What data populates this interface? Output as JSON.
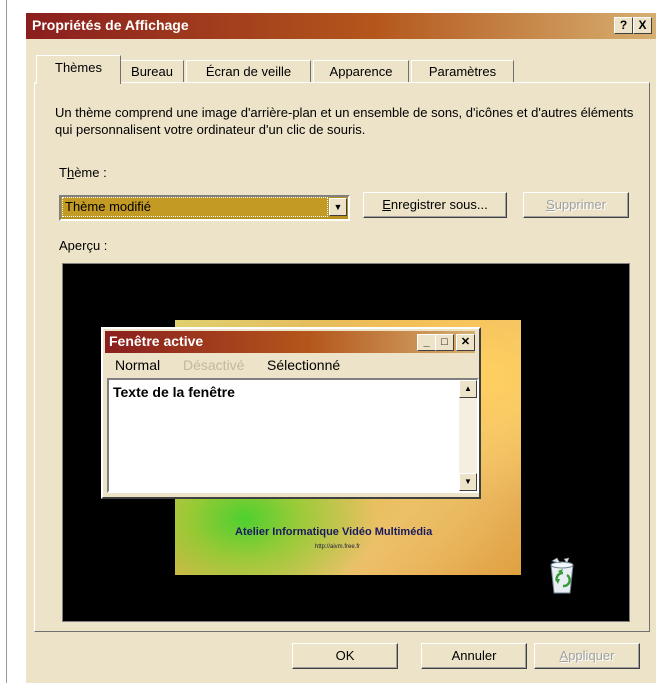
{
  "window": {
    "title": "Propriétés de Affichage",
    "help_label": "?",
    "close_label": "X"
  },
  "tabs": [
    {
      "label": "Thèmes",
      "active": true
    },
    {
      "label": "Bureau",
      "active": false
    },
    {
      "label": "Écran de veille",
      "active": false
    },
    {
      "label": "Apparence",
      "active": false
    },
    {
      "label": "Paramètres",
      "active": false
    }
  ],
  "description": "Un thème comprend une image d'arrière-plan et un ensemble de sons, d'icônes et d'autres éléments qui personnalisent votre ordinateur d'un clic de souris.",
  "theme": {
    "label_pre": "T",
    "label_u": "h",
    "label_post": "ème :",
    "selected": "Thème modifié",
    "save_label_u": "E",
    "save_label_rest": "nregistrer sous...",
    "delete_label_u": "S",
    "delete_label_rest": "upprimer"
  },
  "preview": {
    "label": "Aperçu :",
    "wallpaper_title": "Atelier Informatique Vidéo Multimédia",
    "wallpaper_url": "http://aivm.free.fr",
    "active_window": {
      "title": "Fenêtre active",
      "menu": {
        "normal": "Normal",
        "disabled": "Désactivé",
        "selected": "Sélectionné"
      },
      "text": "Texte de la fenêtre"
    }
  },
  "footer": {
    "ok": "OK",
    "cancel": "Annuler",
    "apply_u": "A",
    "apply_rest": "ppliquer"
  },
  "colors": {
    "title_gradient_start": "#8a1e1e",
    "title_gradient_end": "#d6b070",
    "face": "#ece3c8",
    "selection": "#c29a24"
  }
}
